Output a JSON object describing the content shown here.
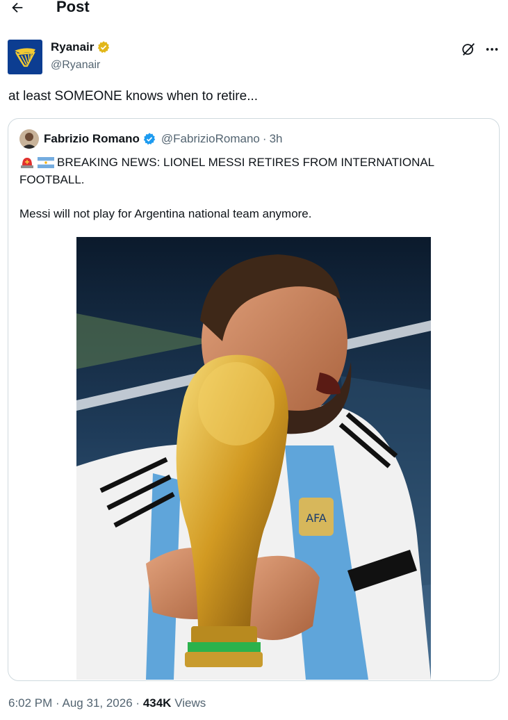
{
  "header": {
    "title": "Post"
  },
  "author": {
    "name": "Ryanair",
    "handle": "@Ryanair",
    "verified": "gold"
  },
  "tweet": {
    "text": "at least SOMEONE knows when to retire..."
  },
  "quoted": {
    "name": "Fabrizio Romano",
    "handle": "@FabrizioRomano",
    "separator": "·",
    "time": "3h",
    "line1": "BREAKING NEWS: LIONEL MESSI RETIRES FROM INTERNATIONAL",
    "line2": "FOOTBALL.",
    "line3": "Messi will not play for Argentina national team anymore."
  },
  "footer": {
    "time": "6:02 PM",
    "date": "Aug 31, 2026",
    "views_count": "434K",
    "views_label": "Views",
    "sep": "·"
  },
  "icons": {
    "back": "arrow-left-icon",
    "grok": "grok-icon",
    "more": "more-icon",
    "verified": "verified-badge-icon",
    "siren": "siren-emoji-icon",
    "flag": "argentina-flag-icon"
  },
  "colors": {
    "text": "#0f1419",
    "secondary": "#536471",
    "border": "#cfd9de",
    "verified_blue": "#1d9bf0",
    "verified_gold": "#e2b719",
    "ryanair_blue": "#0c3d91",
    "ryanair_yellow": "#f1c933"
  }
}
